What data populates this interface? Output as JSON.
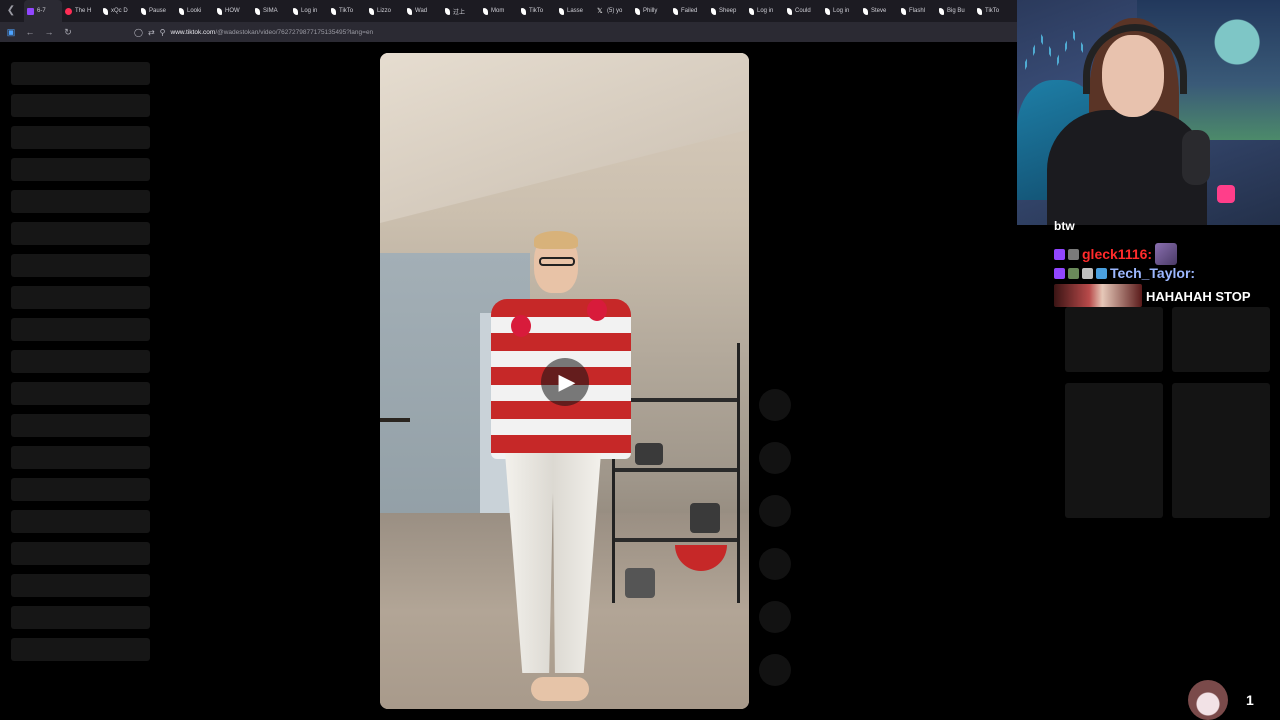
{
  "tabs": [
    {
      "label": "6-7",
      "favicon": "twitch",
      "active": true
    },
    {
      "label": "The H",
      "favicon": "yt"
    },
    {
      "label": "xQc D",
      "favicon": "tiktok"
    },
    {
      "label": "Pause",
      "favicon": "tiktok"
    },
    {
      "label": "Looki",
      "favicon": "tiktok"
    },
    {
      "label": "HOW",
      "favicon": "tiktok"
    },
    {
      "label": "SIMA",
      "favicon": "tiktok"
    },
    {
      "label": "Log in",
      "favicon": "tiktok"
    },
    {
      "label": "TikTo",
      "favicon": "tiktok"
    },
    {
      "label": "Lizzo",
      "favicon": "tiktok"
    },
    {
      "label": "Wad",
      "favicon": "tiktok"
    },
    {
      "label": "过上",
      "favicon": "tiktok"
    },
    {
      "label": "Mom",
      "favicon": "tiktok"
    },
    {
      "label": "TikTo",
      "favicon": "tiktok"
    },
    {
      "label": "Lasse",
      "favicon": "tiktok"
    },
    {
      "label": "(5) yo",
      "favicon": "x"
    },
    {
      "label": "Philly",
      "favicon": "tiktok"
    },
    {
      "label": "Failed",
      "favicon": "tiktok"
    },
    {
      "label": "Sheep",
      "favicon": "tiktok"
    },
    {
      "label": "Log in",
      "favicon": "tiktok"
    },
    {
      "label": "Could",
      "favicon": "tiktok"
    },
    {
      "label": "Log in",
      "favicon": "tiktok"
    },
    {
      "label": "Steve",
      "favicon": "tiktok"
    },
    {
      "label": "Flashl",
      "favicon": "tiktok"
    },
    {
      "label": "Big Bu",
      "favicon": "tiktok"
    },
    {
      "label": "TikTo",
      "favicon": "tiktok"
    }
  ],
  "address": {
    "domain": "www.tiktok.com",
    "path": "/@wadestokan/video/7627279877175135495?lang=en"
  },
  "icons": {
    "tab_back": "chevron-left-icon",
    "back": "arrow-left-icon",
    "forward": "arrow-right-icon",
    "reload": "reload-icon",
    "shield": "shield-icon",
    "play": "play-icon"
  },
  "chat": {
    "cut_off_text": "btw",
    "messages": [
      {
        "user": "gleck1116:",
        "user_color": "#ff2b2b",
        "text": ""
      },
      {
        "user": "Tech_Taylor:",
        "user_color": "#9db8ff",
        "text": "HAHAHAH STOP"
      }
    ]
  },
  "viewer": {
    "count": "1"
  },
  "colors": {
    "background": "#000000",
    "tab_strip": "#1c1b22",
    "address_bar": "#2b2a33",
    "skeleton": "#161616"
  }
}
